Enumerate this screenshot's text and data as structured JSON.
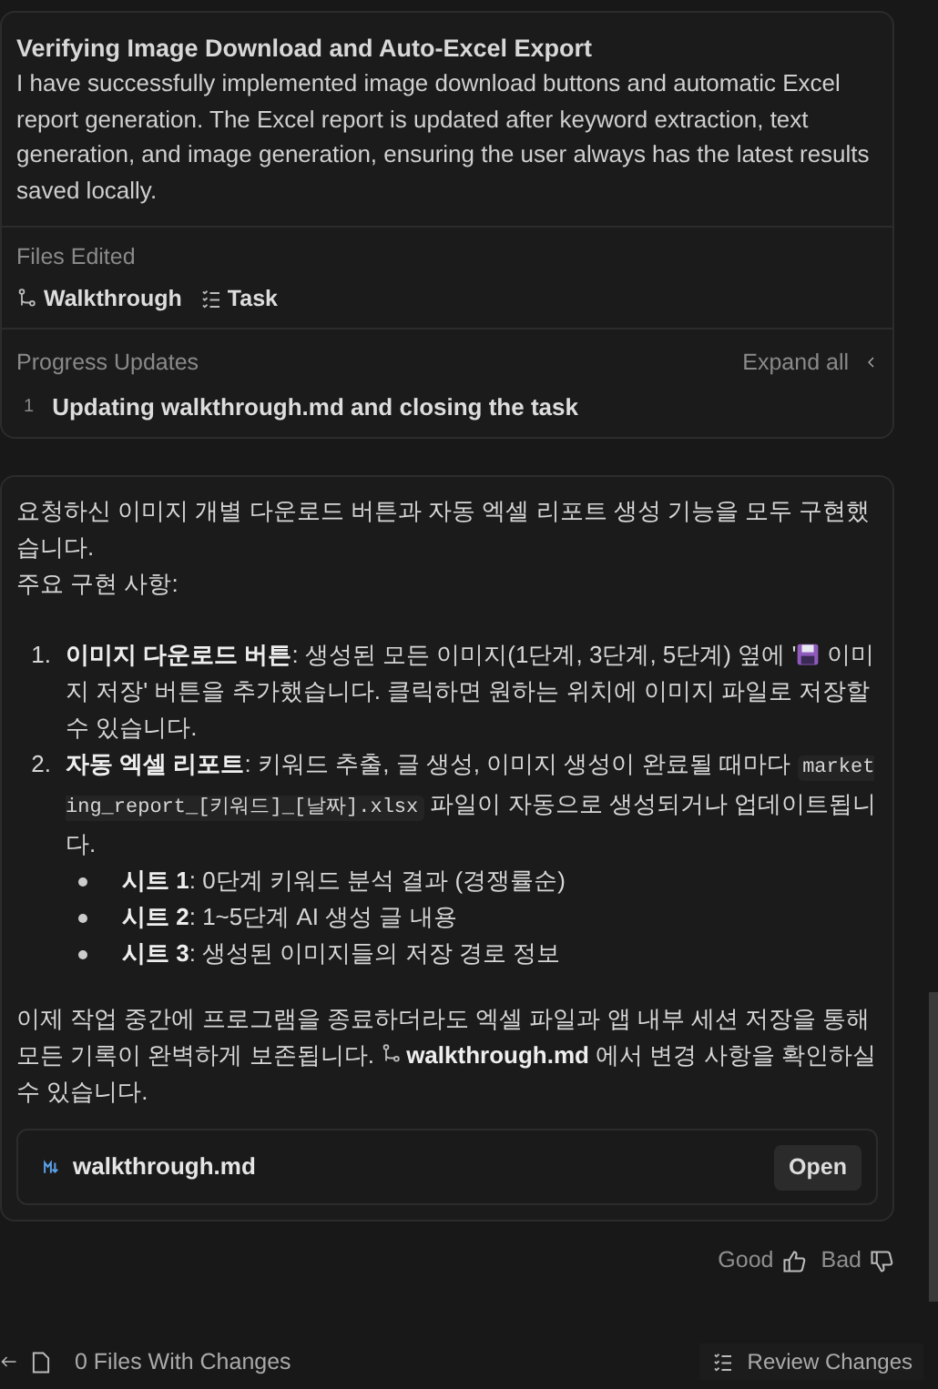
{
  "step_card": {
    "title": "Verifying Image Download and Auto-Excel Export",
    "body": "I have successfully implemented image download buttons and automatic Excel report generation. The Excel report is updated after keyword extraction, text generation, and image generation, ensuring the user always has the latest results saved locally.",
    "files_edited": {
      "label": "Files Edited",
      "files": [
        {
          "kind": "walkthrough",
          "name": "Walkthrough"
        },
        {
          "kind": "task",
          "name": "Task"
        }
      ]
    },
    "progress": {
      "label": "Progress Updates",
      "expand": "Expand all",
      "items": [
        {
          "number": "1",
          "text": "Updating walkthrough.md and closing the task"
        }
      ]
    }
  },
  "message": {
    "intro": "요청하신 이미지 개별 다운로드 버튼과 자동 엑셀 리포트 생성 기능을 모두 구현했습니다.\n주요 구현 사항:",
    "items": [
      {
        "number": "1.",
        "parts": [
          {
            "kind": "bold",
            "text": "이미지 다운로드 버튼"
          },
          {
            "kind": "text",
            "text": ": 생성된 모든 이미지(1단계, 3단계, 5단계) 옆에 '"
          },
          {
            "kind": "save_icon"
          },
          {
            "kind": "text",
            "text": " 이미지 저장' 버튼을 추가했습니다. 클릭하면 원하는 위치에 이미지 파일로 저장할 수 있습니다."
          }
        ]
      },
      {
        "number": "2.",
        "parts": [
          {
            "kind": "bold",
            "text": "자동 엑셀 리포트"
          },
          {
            "kind": "text",
            "text": ": 키워드 추출, 글 생성, 이미지 생성이 완료될 때마다 "
          },
          {
            "kind": "code",
            "text": "marketing_report_[키워드]_[날짜].xlsx"
          },
          {
            "kind": "text",
            "text": " 파일이 자동으로 생성되거나 업데이트됩니다."
          }
        ],
        "bullets": [
          {
            "label": "시트 1",
            "text": ": 0단계 키워드 분석 결과 (경쟁률순)"
          },
          {
            "label": "시트 2",
            "text": ": 1~5단계 AI 생성 글 내용"
          },
          {
            "label": "시트 3",
            "text": ": 생성된 이미지들의 저장 경로 정보"
          }
        ]
      }
    ],
    "outro": [
      {
        "kind": "text",
        "text": "이제 작업 중간에 프로그램을 종료하더라도 엑셀 파일과 앱 내부 세션 저장을 통해 모든 기록이 완벽하게 보존됩니다. "
      },
      {
        "kind": "link",
        "text": "walkthrough.md"
      },
      {
        "kind": "text",
        "text": " 에서 변경 사항을 확인하실 수 있습니다."
      }
    ],
    "attachment": {
      "name": "walkthrough.md",
      "button": "Open"
    }
  },
  "feedback": [
    {
      "kind": "good",
      "label": "Good"
    },
    {
      "kind": "bad",
      "label": "Bad"
    }
  ],
  "footer": {
    "files": "0 Files With Changes",
    "review": "Review Changes"
  }
}
